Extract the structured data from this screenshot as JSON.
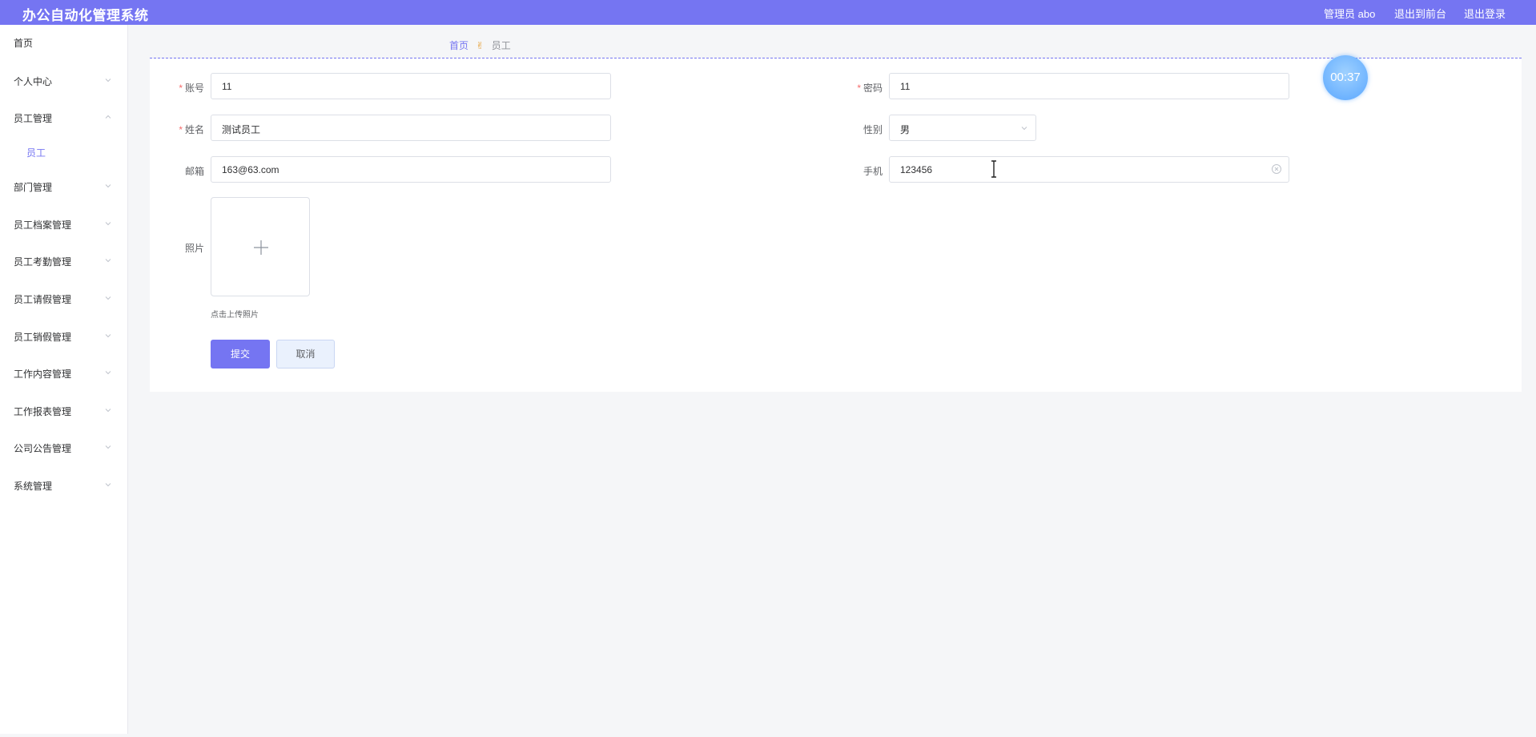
{
  "app": {
    "title": "办公自动化管理系统"
  },
  "topbar": {
    "user_label": "管理员 abo",
    "front_link": "退出到前台",
    "logout_link": "退出登录"
  },
  "sidebar": {
    "items": [
      {
        "label": "首页",
        "expandable": false
      },
      {
        "label": "个人中心",
        "expandable": true
      },
      {
        "label": "员工管理",
        "expandable": true,
        "expanded": true
      },
      {
        "label": "员工",
        "sub": true
      },
      {
        "label": "部门管理",
        "expandable": true
      },
      {
        "label": "员工档案管理",
        "expandable": true
      },
      {
        "label": "员工考勤管理",
        "expandable": true
      },
      {
        "label": "员工请假管理",
        "expandable": true
      },
      {
        "label": "员工销假管理",
        "expandable": true
      },
      {
        "label": "工作内容管理",
        "expandable": true
      },
      {
        "label": "工作报表管理",
        "expandable": true
      },
      {
        "label": "公司公告管理",
        "expandable": true
      },
      {
        "label": "系统管理",
        "expandable": true
      }
    ]
  },
  "breadcrumb": {
    "home": "首页",
    "current": "员工"
  },
  "timer": "00:37",
  "form": {
    "account": {
      "label": "账号",
      "value": "11",
      "required": true
    },
    "password": {
      "label": "密码",
      "value": "11",
      "required": true
    },
    "name": {
      "label": "姓名",
      "value": "测试员工",
      "required": true
    },
    "gender": {
      "label": "性别",
      "value": "男"
    },
    "email": {
      "label": "邮箱",
      "value": "163@63.com"
    },
    "phone": {
      "label": "手机",
      "value": "123456"
    },
    "photo": {
      "label": "照片",
      "hint": "点击上传照片"
    },
    "submit_label": "提交",
    "cancel_label": "取消"
  },
  "colors": {
    "accent": "#7575f2",
    "required": "#f56c6c",
    "border": "#dcdfe6"
  },
  "icons": {
    "chevron": "chevron-down-icon",
    "plus": "plus-icon",
    "clear": "circle-close-icon"
  }
}
